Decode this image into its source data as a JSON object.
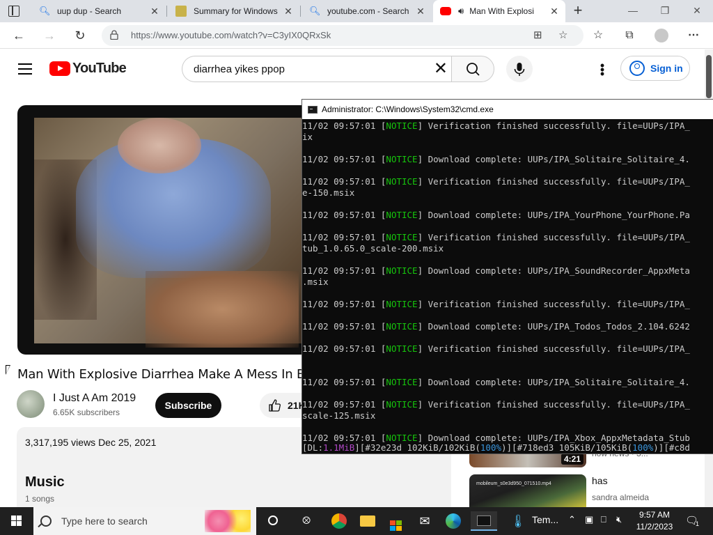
{
  "browser": {
    "tabs": [
      {
        "title": "uup dup - Search",
        "favicon": "search-icon",
        "close": "✕"
      },
      {
        "title": "Summary for Windows",
        "favicon": "uupdump-icon",
        "close": "✕"
      },
      {
        "title": "youtube.com - Search",
        "favicon": "search-icon",
        "close": "✕"
      },
      {
        "title": "Man With Explosi",
        "favicon": "youtube-icon",
        "close": "✕",
        "active": true
      }
    ],
    "new_tab": "+",
    "url": "https://www.youtube.com/watch?v=C3yIX0QRxSk",
    "window_controls": {
      "minimize": "—",
      "restore": "❐",
      "close": "✕"
    }
  },
  "youtube": {
    "logo_text": "YouTube",
    "search_query": "diarrhea yikes ppop",
    "sign_in": "Sign in",
    "video_title": "Man With Explosive Diarrhea Make A Mess In Ba",
    "channel_name": "I Just A Am 2019",
    "subscribers": "6.65K subscribers",
    "subscribe_label": "Subscribe",
    "like_count": "21K",
    "description": {
      "views_date": "3,317,195 views  Dec 25, 2021",
      "music_heading": "Music",
      "music_count": "1 songs"
    },
    "recommendations": [
      {
        "duration": "4:21",
        "side_text": "how news · 3..."
      },
      {
        "title": "has",
        "channel": "sandra almeida",
        "thumb_caption": "mobileum_s0e3d950_071510.mp4"
      }
    ]
  },
  "cmd": {
    "title": "Administrator: C:\\Windows\\System32\\cmd.exe",
    "lines": [
      {
        "ts": "11/02 09:57:01 [",
        "lvl": "NOTICE",
        "msg": "] Verification finished successfully. file=UUPs/IPA_"
      },
      {
        "ts": "ix",
        "lvl": "",
        "msg": ""
      },
      {
        "ts": "",
        "lvl": "",
        "msg": ""
      },
      {
        "ts": "11/02 09:57:01 [",
        "lvl": "NOTICE",
        "msg": "] Download complete: UUPs/IPA_Solitaire_Solitaire_4."
      },
      {
        "ts": "",
        "lvl": "",
        "msg": ""
      },
      {
        "ts": "11/02 09:57:01 [",
        "lvl": "NOTICE",
        "msg": "] Verification finished successfully. file=UUPs/IPA_"
      },
      {
        "ts": "e-150.msix",
        "lvl": "",
        "msg": ""
      },
      {
        "ts": "",
        "lvl": "",
        "msg": ""
      },
      {
        "ts": "11/02 09:57:01 [",
        "lvl": "NOTICE",
        "msg": "] Download complete: UUPs/IPA_YourPhone_YourPhone.Pa"
      },
      {
        "ts": "",
        "lvl": "",
        "msg": ""
      },
      {
        "ts": "11/02 09:57:01 [",
        "lvl": "NOTICE",
        "msg": "] Verification finished successfully. file=UUPs/IPA_"
      },
      {
        "ts": "tub_1.0.65.0_scale-200.msix",
        "lvl": "",
        "msg": ""
      },
      {
        "ts": "",
        "lvl": "",
        "msg": ""
      },
      {
        "ts": "11/02 09:57:01 [",
        "lvl": "NOTICE",
        "msg": "] Download complete: UUPs/IPA_SoundRecorder_AppxMeta"
      },
      {
        "ts": ".msix",
        "lvl": "",
        "msg": ""
      },
      {
        "ts": "",
        "lvl": "",
        "msg": ""
      },
      {
        "ts": "11/02 09:57:01 [",
        "lvl": "NOTICE",
        "msg": "] Verification finished successfully. file=UUPs/IPA_"
      },
      {
        "ts": "",
        "lvl": "",
        "msg": ""
      },
      {
        "ts": "11/02 09:57:01 [",
        "lvl": "NOTICE",
        "msg": "] Download complete: UUPs/IPA_Todos_Todos_2.104.6242"
      },
      {
        "ts": "",
        "lvl": "",
        "msg": ""
      },
      {
        "ts": "11/02 09:57:01 [",
        "lvl": "NOTICE",
        "msg": "] Verification finished successfully. file=UUPs/IPA_"
      },
      {
        "ts": "",
        "lvl": "",
        "msg": ""
      },
      {
        "ts": "",
        "lvl": "",
        "msg": ""
      },
      {
        "ts": "11/02 09:57:01 [",
        "lvl": "NOTICE",
        "msg": "] Download complete: UUPs/IPA_Solitaire_Solitaire_4."
      },
      {
        "ts": "",
        "lvl": "",
        "msg": ""
      },
      {
        "ts": "11/02 09:57:01 [",
        "lvl": "NOTICE",
        "msg": "] Verification finished successfully. file=UUPs/IPA_"
      },
      {
        "ts": "scale-125.msix",
        "lvl": "",
        "msg": ""
      },
      {
        "ts": "",
        "lvl": "",
        "msg": ""
      },
      {
        "ts": "11/02 09:57:01 [",
        "lvl": "NOTICE",
        "msg": "] Download complete: UUPs/IPA_Xbox_AppxMetadata_Stub"
      }
    ],
    "status": {
      "dl_prefix": "[DL:",
      "dl_value": "1.1MiB",
      "seg1": "][#32e23d 102KiB/102KiB(",
      "pct1": "100%",
      "seg2": ")][#718ed3 105KiB/105KiB(",
      "pct2": "100%",
      "seg3": ")][#c8d"
    }
  },
  "taskbar": {
    "search_placeholder": "Type here to search",
    "apps": [
      "cortana-icon",
      "task-view-icon",
      "chrome-icon",
      "file-explorer-icon",
      "store-icon",
      "mail-icon",
      "edge-icon",
      "terminal-icon"
    ],
    "weather_text": "Tem...",
    "time": "9:57 AM",
    "date": "11/2/2023",
    "notification_count": "1"
  },
  "colors": {
    "notice_green": "#16c60c",
    "yt_red": "#ff0000",
    "link_blue": "#065fd4",
    "status_purple": "#b148c6",
    "status_cyan": "#3a96dd"
  }
}
